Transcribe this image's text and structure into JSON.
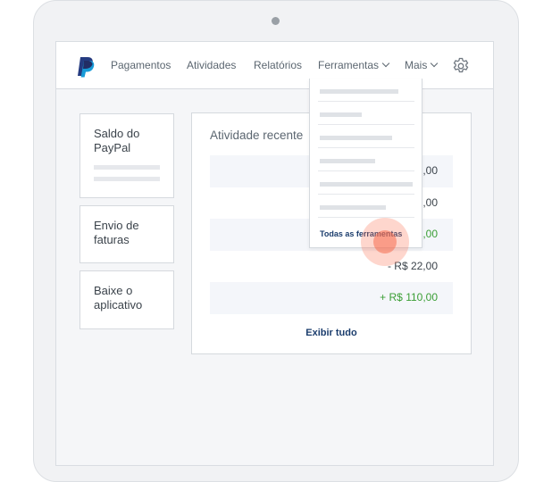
{
  "nav": {
    "items": [
      "Pagamentos",
      "Atividades",
      "Relatórios"
    ],
    "tools_label": "Ferramentas",
    "more_label": "Mais"
  },
  "sidebar": {
    "balance_label": "Saldo do PayPal",
    "invoice_label": "Envio de faturas",
    "app_label": "Baixe o aplicativo"
  },
  "activity": {
    "title": "Atividade recente",
    "rows": [
      ",00",
      "7,00",
      "5,00",
      "- R$ 22,00",
      "+ R$ 110,00"
    ],
    "view_all": "Exibir tudo"
  },
  "tools_menu": {
    "all_tools": "Todas as ferramentas"
  },
  "colors": {
    "brand_dark": "#1b3d6d",
    "positive": "#3a9e35",
    "tap_indicator": "#f56e50"
  }
}
